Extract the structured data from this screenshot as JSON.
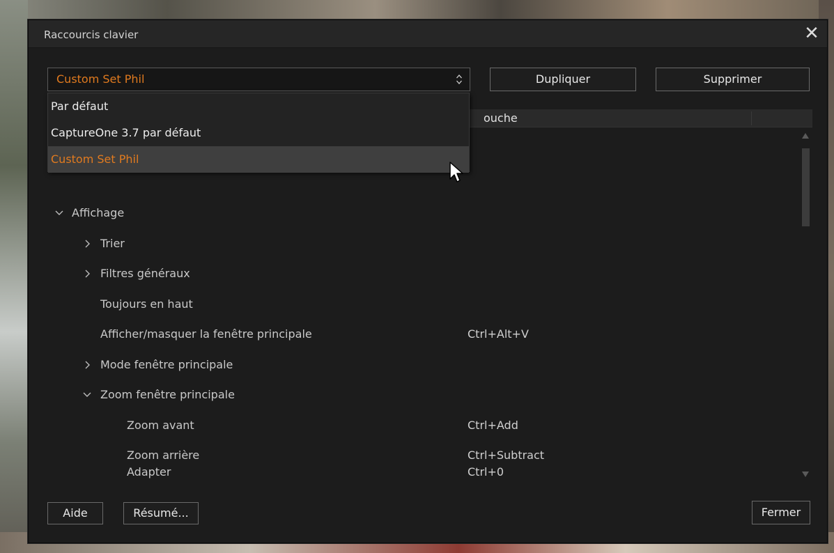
{
  "dialog": {
    "title": "Raccourcis clavier",
    "close_glyph": "✕"
  },
  "preset": {
    "selected": "Custom Set Phil",
    "options": [
      "Par défaut",
      "CaptureOne 3.7 par défaut",
      "Custom Set Phil"
    ]
  },
  "buttons": {
    "duplicate": "Dupliquer",
    "delete": "Supprimer",
    "help": "Aide",
    "summary": "Résumé...",
    "close": "Fermer"
  },
  "columns": {
    "key_header": "Touche",
    "key_header_visible": "ouche"
  },
  "tree": [
    {
      "label": "Affichage",
      "expanded": true,
      "shortcut": ""
    },
    {
      "label": "Trier",
      "expanded": false,
      "shortcut": ""
    },
    {
      "label": "Filtres généraux",
      "expanded": false,
      "shortcut": ""
    },
    {
      "label": "Toujours en haut",
      "shortcut": ""
    },
    {
      "label": "Afficher/masquer la fenêtre principale",
      "shortcut": "Ctrl+Alt+V"
    },
    {
      "label": "Mode fenêtre principale",
      "expanded": false,
      "shortcut": ""
    },
    {
      "label": "Zoom fenêtre principale",
      "expanded": true,
      "shortcut": ""
    },
    {
      "label": "Zoom avant",
      "shortcut": "Ctrl+Add"
    },
    {
      "label": "Zoom arrière",
      "shortcut": "Ctrl+Subtract"
    },
    {
      "label": "Adapter",
      "shortcut": "Ctrl+0"
    }
  ],
  "colors": {
    "accent": "#e07a1f",
    "dialog_bg": "#1c1c1c",
    "selected_item_bg": "#3f3f3f"
  },
  "icons": {
    "chevron_expanded": "chevron-down-icon",
    "chevron_collapsed": "chevron-right-icon",
    "select_arrows": "up-down-arrows-icon",
    "close": "close-icon",
    "cursor": "mouse-pointer-icon"
  }
}
